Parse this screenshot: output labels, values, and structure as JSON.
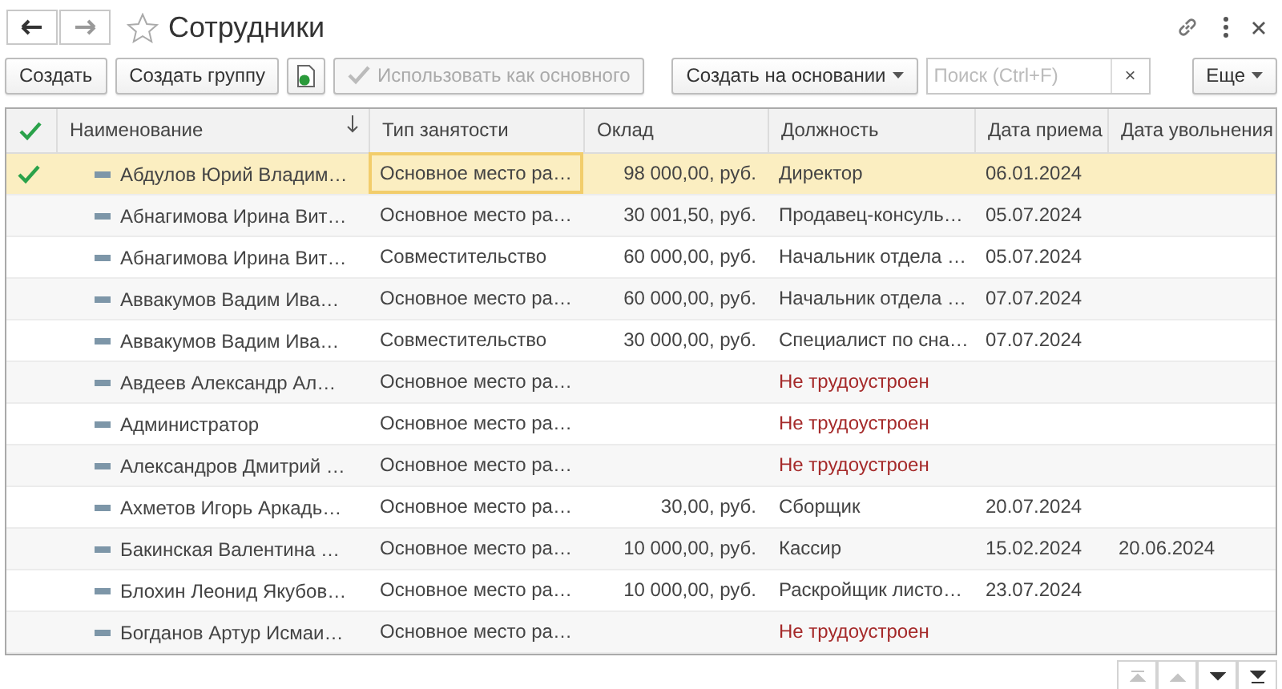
{
  "window": {
    "title": "Сотрудники",
    "favorite": false
  },
  "toolbar": [
    {
      "kind": "button",
      "label": "Создать",
      "disabled": false
    },
    {
      "kind": "button",
      "label": "Создать группу",
      "disabled": false
    },
    {
      "kind": "icon",
      "disabled": false
    },
    {
      "kind": "check",
      "label": "Использовать как основного",
      "disabled": true
    },
    {
      "kind": "dropdown",
      "label": "Создать на основании",
      "disabled": false
    }
  ],
  "search": {
    "placeholder": "Поиск (Ctrl+F)",
    "clear": "×"
  },
  "more": {
    "label": "Еще"
  },
  "table": {
    "columns": [
      "Наименование",
      "Тип занятости",
      "Оклад",
      "Должность",
      "Дата приема",
      "Дата увольнения"
    ],
    "rows": [
      {
        "main": true,
        "selected": true,
        "name": "Абдулов Юрий Владим…",
        "type": "Основное место ра…",
        "salary": "98 000,00, руб.",
        "position": "Директор",
        "warning": false,
        "hired": "06.01.2024",
        "fired": ""
      },
      {
        "main": false,
        "selected": false,
        "name": "Абнагимова Ирина Вит…",
        "type": "Основное место ра…",
        "salary": "30 001,50, руб.",
        "position": "Продавец-консуль…",
        "warning": false,
        "hired": "05.07.2024",
        "fired": ""
      },
      {
        "main": false,
        "selected": false,
        "name": "Абнагимова Ирина Вит…",
        "type": "Совместительство",
        "salary": "60 000,00, руб.",
        "position": "Начальник отдела …",
        "warning": false,
        "hired": "05.07.2024",
        "fired": ""
      },
      {
        "main": false,
        "selected": false,
        "name": "Аввакумов Вадим Ива…",
        "type": "Основное место ра…",
        "salary": "60 000,00, руб.",
        "position": "Начальник отдела …",
        "warning": false,
        "hired": "07.07.2024",
        "fired": ""
      },
      {
        "main": false,
        "selected": false,
        "name": "Аввакумов Вадим Ива…",
        "type": "Совместительство",
        "salary": "30 000,00, руб.",
        "position": "Специалист по сна…",
        "warning": false,
        "hired": "07.07.2024",
        "fired": ""
      },
      {
        "main": false,
        "selected": false,
        "name": "Авдеев Александр Ал…",
        "type": "Основное место ра…",
        "salary": "",
        "position": "Не трудоустроен",
        "warning": true,
        "hired": "",
        "fired": ""
      },
      {
        "main": false,
        "selected": false,
        "name": "Администратор",
        "type": "Основное место ра…",
        "salary": "",
        "position": "Не трудоустроен",
        "warning": true,
        "hired": "",
        "fired": ""
      },
      {
        "main": false,
        "selected": false,
        "name": "Александров Дмитрий …",
        "type": "Основное место ра…",
        "salary": "",
        "position": "Не трудоустроен",
        "warning": true,
        "hired": "",
        "fired": ""
      },
      {
        "main": false,
        "selected": false,
        "name": "Ахметов Игорь Аркадь…",
        "type": "Основное место ра…",
        "salary": "30,00, руб.",
        "position": "Сборщик",
        "warning": false,
        "hired": "20.07.2024",
        "fired": ""
      },
      {
        "main": false,
        "selected": false,
        "name": "Бакинская Валентина …",
        "type": "Основное место ра…",
        "salary": "10 000,00, руб.",
        "position": "Кассир",
        "warning": false,
        "hired": "15.02.2024",
        "fired": "20.06.2024"
      },
      {
        "main": false,
        "selected": false,
        "name": "Блохин Леонид Якубов…",
        "type": "Основное место ра…",
        "salary": "10 000,00, руб.",
        "position": "Раскройщик листо…",
        "warning": false,
        "hired": "23.07.2024",
        "fired": ""
      },
      {
        "main": false,
        "selected": false,
        "name": "Богданов Артур Исмаи…",
        "type": "Основное место ра…",
        "salary": "",
        "position": "Не трудоустроен",
        "warning": true,
        "hired": "",
        "fired": ""
      }
    ]
  },
  "scroll_buttons": [
    {
      "kind": "first",
      "disabled": true
    },
    {
      "kind": "up",
      "disabled": true
    },
    {
      "kind": "down",
      "disabled": false
    },
    {
      "kind": "last",
      "disabled": false
    }
  ]
}
